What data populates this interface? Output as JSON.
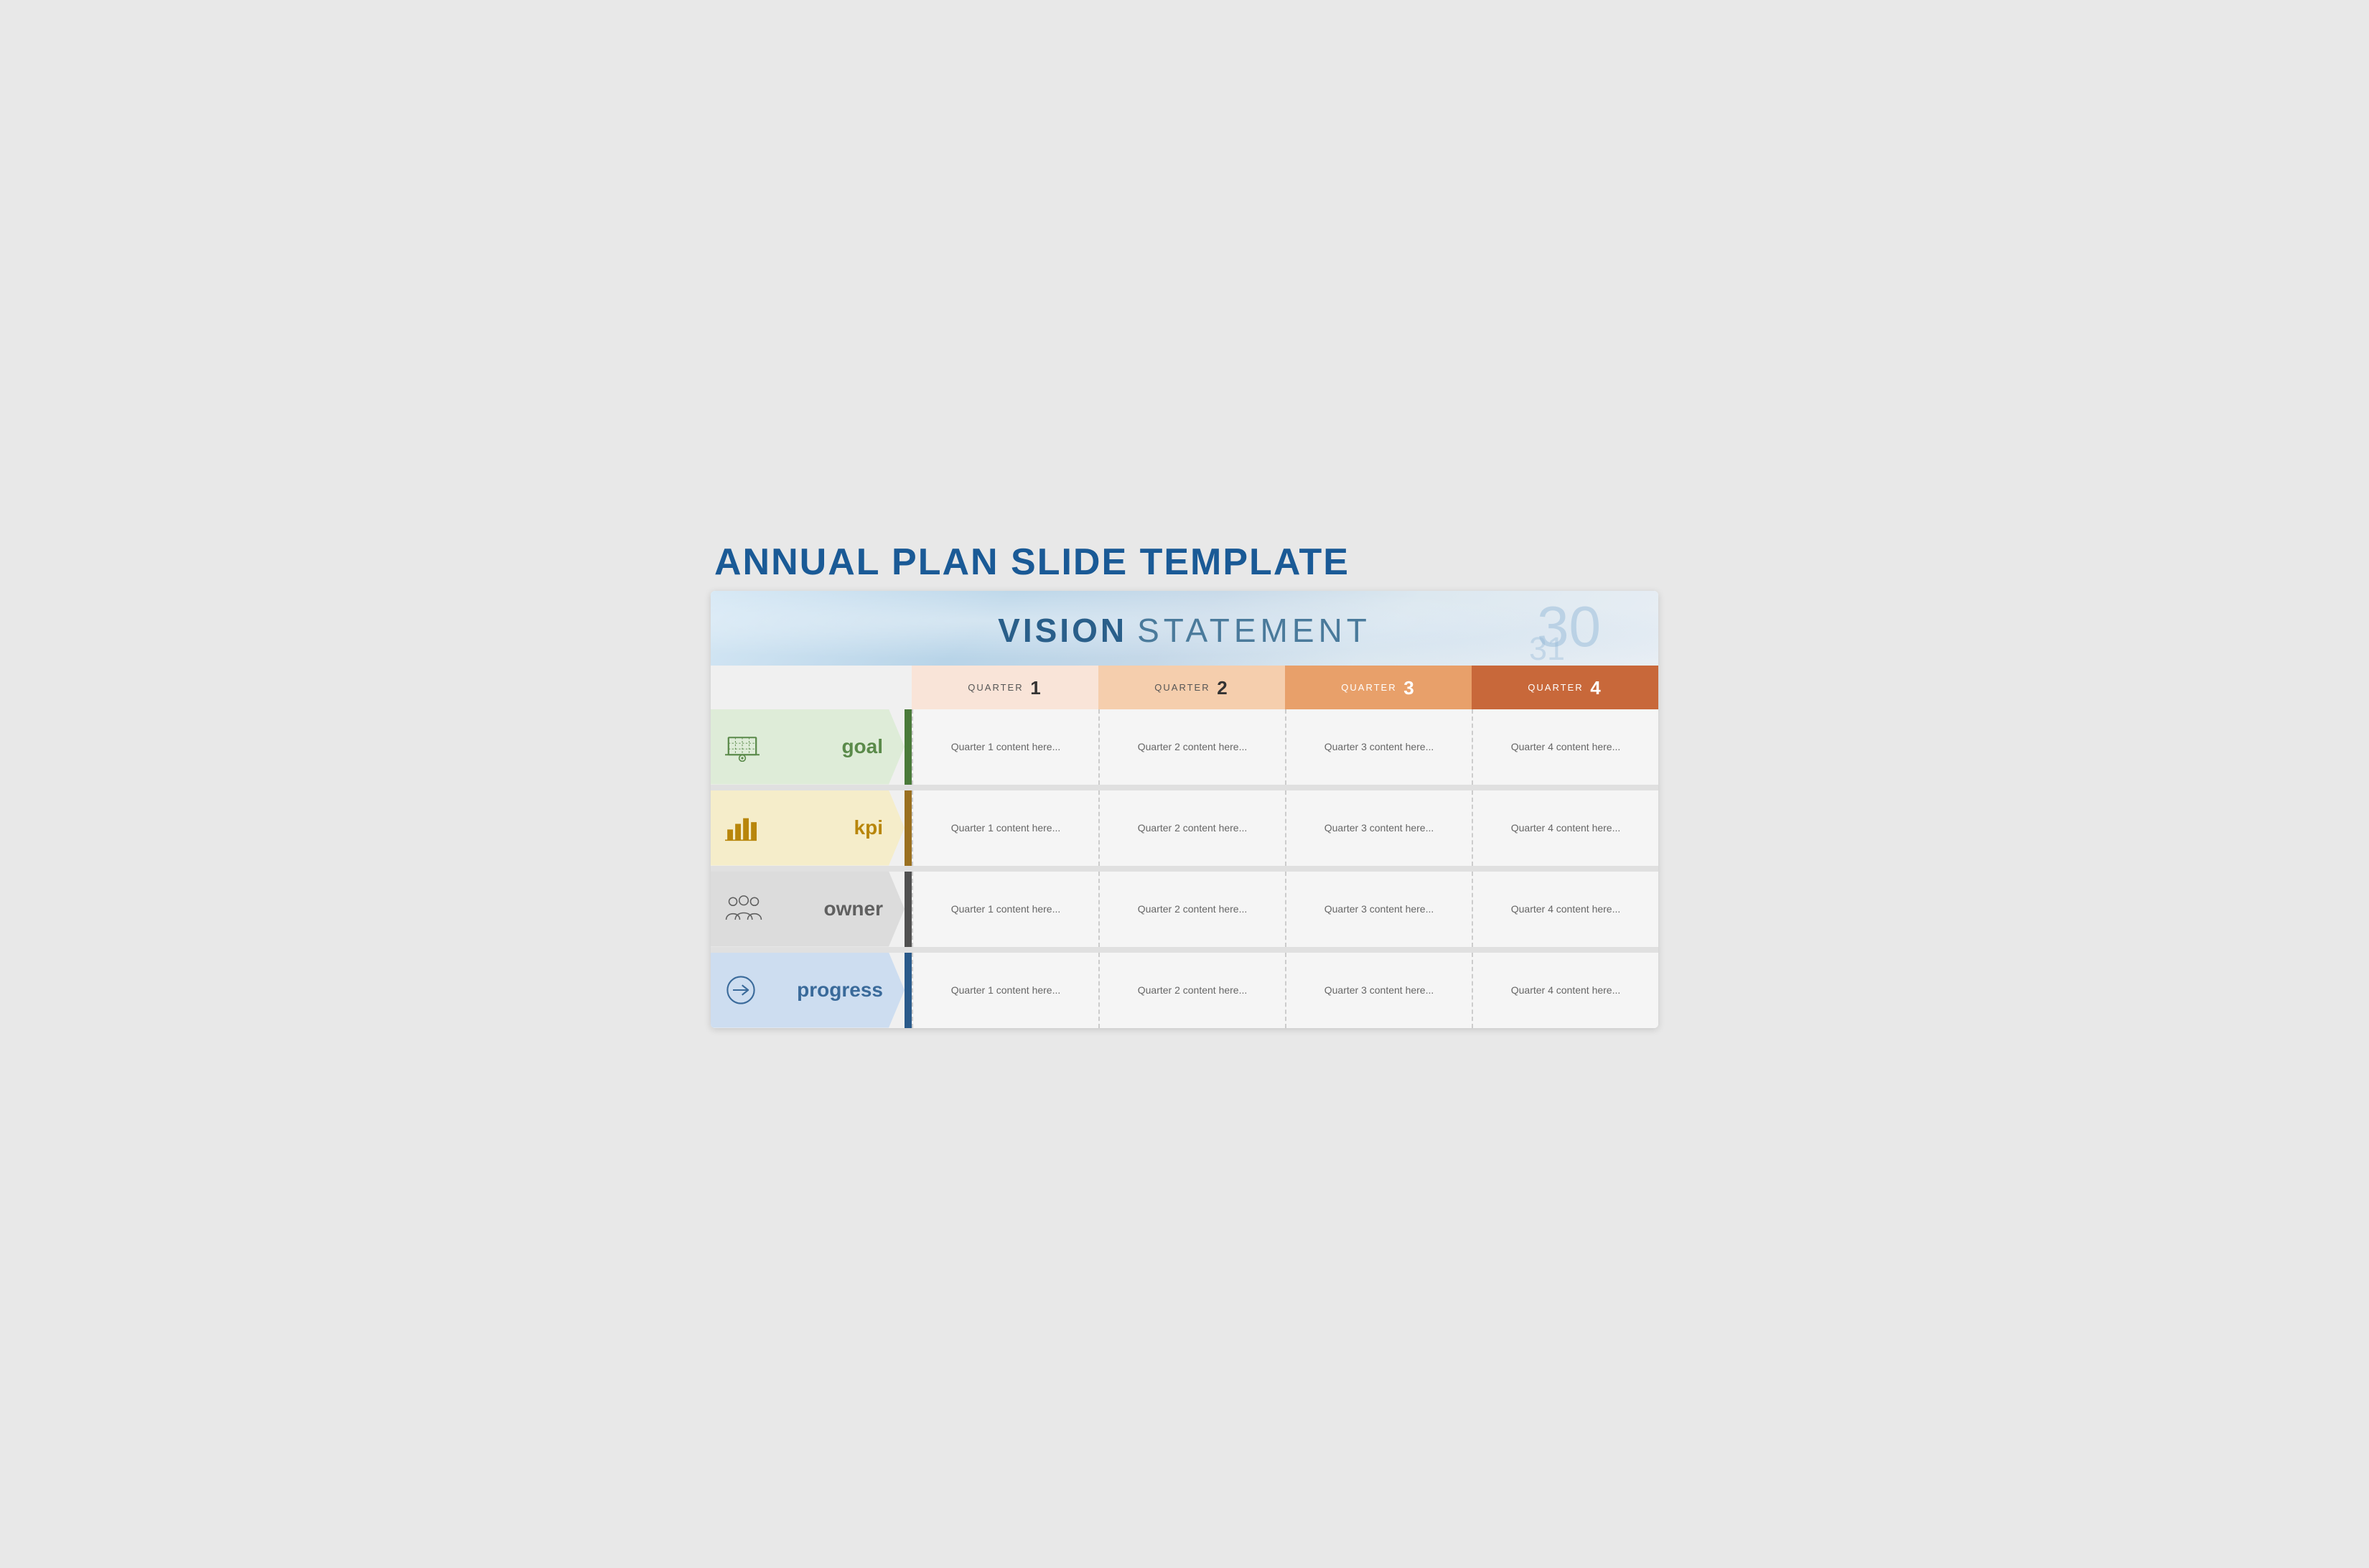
{
  "title": "ANNUAL PLAN SLIDE TEMPLATE",
  "vision": {
    "bold": "VISION",
    "light": "STATEMENT"
  },
  "quarters": [
    {
      "label": "QUARTER",
      "number": "1",
      "class": "qh-1"
    },
    {
      "label": "QUARTER",
      "number": "2",
      "class": "qh-2"
    },
    {
      "label": "QUARTER",
      "number": "3",
      "class": "qh-3"
    },
    {
      "label": "QUARTER",
      "number": "4",
      "class": "qh-4"
    }
  ],
  "rows": [
    {
      "id": "goal",
      "label": "goal",
      "cells": [
        "Quarter 1 content here...",
        "Quarter 2 content here...",
        "Quarter 3 content here...",
        "Quarter 4 content here..."
      ]
    },
    {
      "id": "kpi",
      "label": "kpi",
      "cells": [
        "Quarter 1 content here...",
        "Quarter 2 content here...",
        "Quarter 3 content here...",
        "Quarter 4 content here..."
      ]
    },
    {
      "id": "owner",
      "label": "owner",
      "cells": [
        "Quarter 1 content here...",
        "Quarter 2 content here...",
        "Quarter 3 content here...",
        "Quarter 4 content here..."
      ]
    },
    {
      "id": "progress",
      "label": "progress",
      "cells": [
        "Quarter 1 content here...",
        "Quarter 2 content here...",
        "Quarter 3 content here...",
        "Quarter 4 content here..."
      ]
    }
  ]
}
